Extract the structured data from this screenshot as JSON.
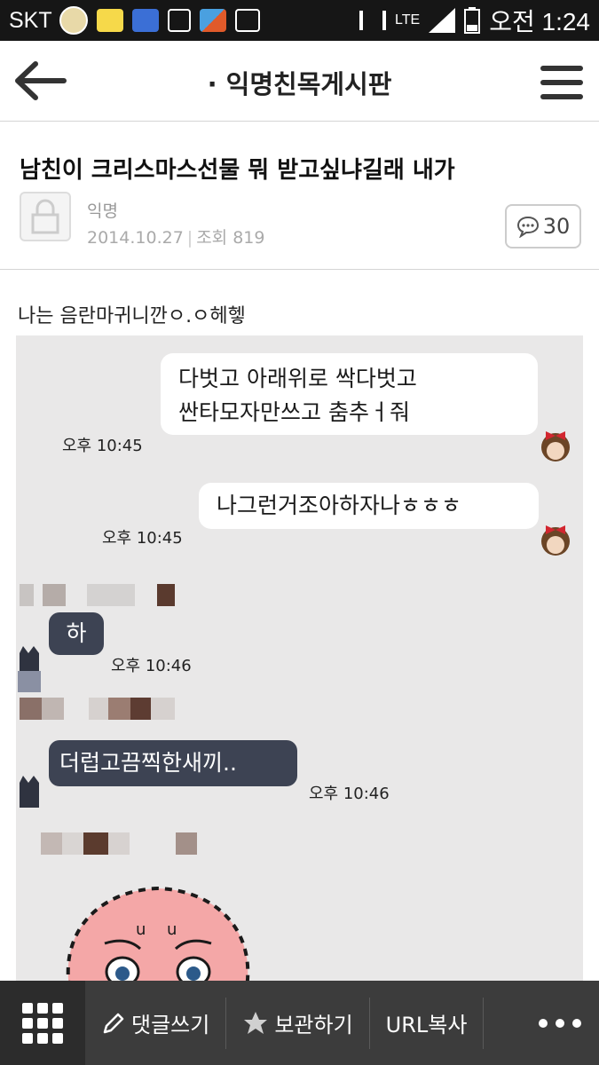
{
  "status_bar": {
    "carrier": "SKT",
    "network": "LTE",
    "time": "오전 1:24",
    "icons": [
      "paw-30-icon",
      "kakaotalk-icon",
      "naver-icon",
      "gallery-icon",
      "cleaner-icon",
      "screenshot-icon",
      "mute-icon",
      "signal-icon",
      "battery-icon"
    ]
  },
  "header": {
    "title": "· 익명친목게시판"
  },
  "post": {
    "title": "남친이 크리스마스선물 뭐 받고싶냐길래 내가",
    "author": "익명",
    "date": "2014.10.27",
    "views": "조회 819",
    "comment_count": "30",
    "body": "나는 음란마귀니깐ㅇ.ㅇ헤헿"
  },
  "chat": {
    "messages": [
      {
        "side": "sent",
        "lines": [
          "다벗고 아래위로 싹다벗고",
          "싼타모자만쓰고 춤추ㅓ줘"
        ],
        "time": "오후 10:45"
      },
      {
        "side": "sent",
        "lines": [
          "나그런거조아하자나ㅎㅎㅎ"
        ],
        "time": "오후 10:45"
      },
      {
        "side": "received",
        "lines": [
          "하"
        ],
        "time": "오후 10:46"
      },
      {
        "side": "received",
        "lines": [
          "더럽고끔찍한새끼.."
        ],
        "time": "오후 10:46"
      }
    ],
    "colors": {
      "background": "#e9e8e8",
      "sent_bubble": "#ffffff",
      "received_bubble": "#3d4353"
    }
  },
  "bottom_bar": {
    "write_comment": "댓글쓰기",
    "save": "보관하기",
    "copy_url": "URL복사"
  }
}
